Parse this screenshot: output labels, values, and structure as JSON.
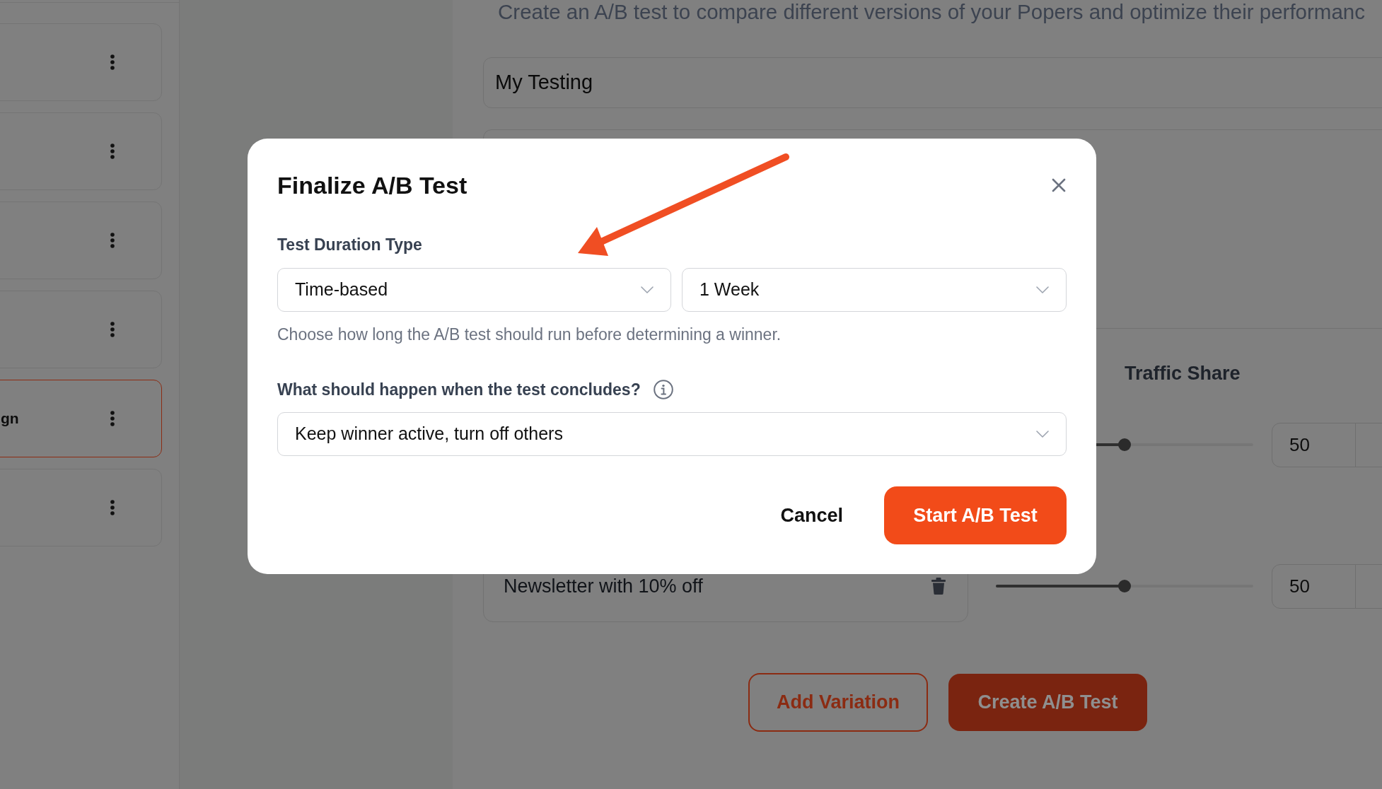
{
  "sidebar": {
    "cards": [
      {
        "selected": false
      },
      {
        "selected": false
      },
      {
        "selected": false
      },
      {
        "selected": false
      },
      {
        "label": "gn",
        "selected": true
      },
      {
        "selected": false
      }
    ]
  },
  "page": {
    "description": "Create an A/B test to compare different versions of your Popers and optimize their performanc",
    "name_field": {
      "value": "My Testing"
    },
    "traffic_share_heading": "Traffic Share",
    "variations": [
      {
        "level": 0.5,
        "share": "50"
      },
      {
        "name": "Newsletter with 10% off",
        "level": 0.5,
        "share": "50"
      }
    ],
    "buttons": [
      {
        "label": "Add Variation",
        "kind": "outline"
      },
      {
        "label": "Create A/B Test",
        "kind": "primary"
      }
    ]
  },
  "dialog": {
    "title": "Finalize A/B Test",
    "duration_label": "Test Duration Type",
    "duration_type": {
      "value": "Time-based"
    },
    "duration": {
      "value": "1 Week"
    },
    "help_text": "Choose how long the A/B test should run before determining a winner.",
    "conclusion_label": "What should happen when the test concludes?",
    "conclusion": {
      "value": "Keep winner active, turn off others"
    },
    "buttons": [
      {
        "label": "Cancel",
        "kind": "text"
      },
      {
        "label": "Start A/B Test",
        "kind": "primary"
      }
    ]
  }
}
